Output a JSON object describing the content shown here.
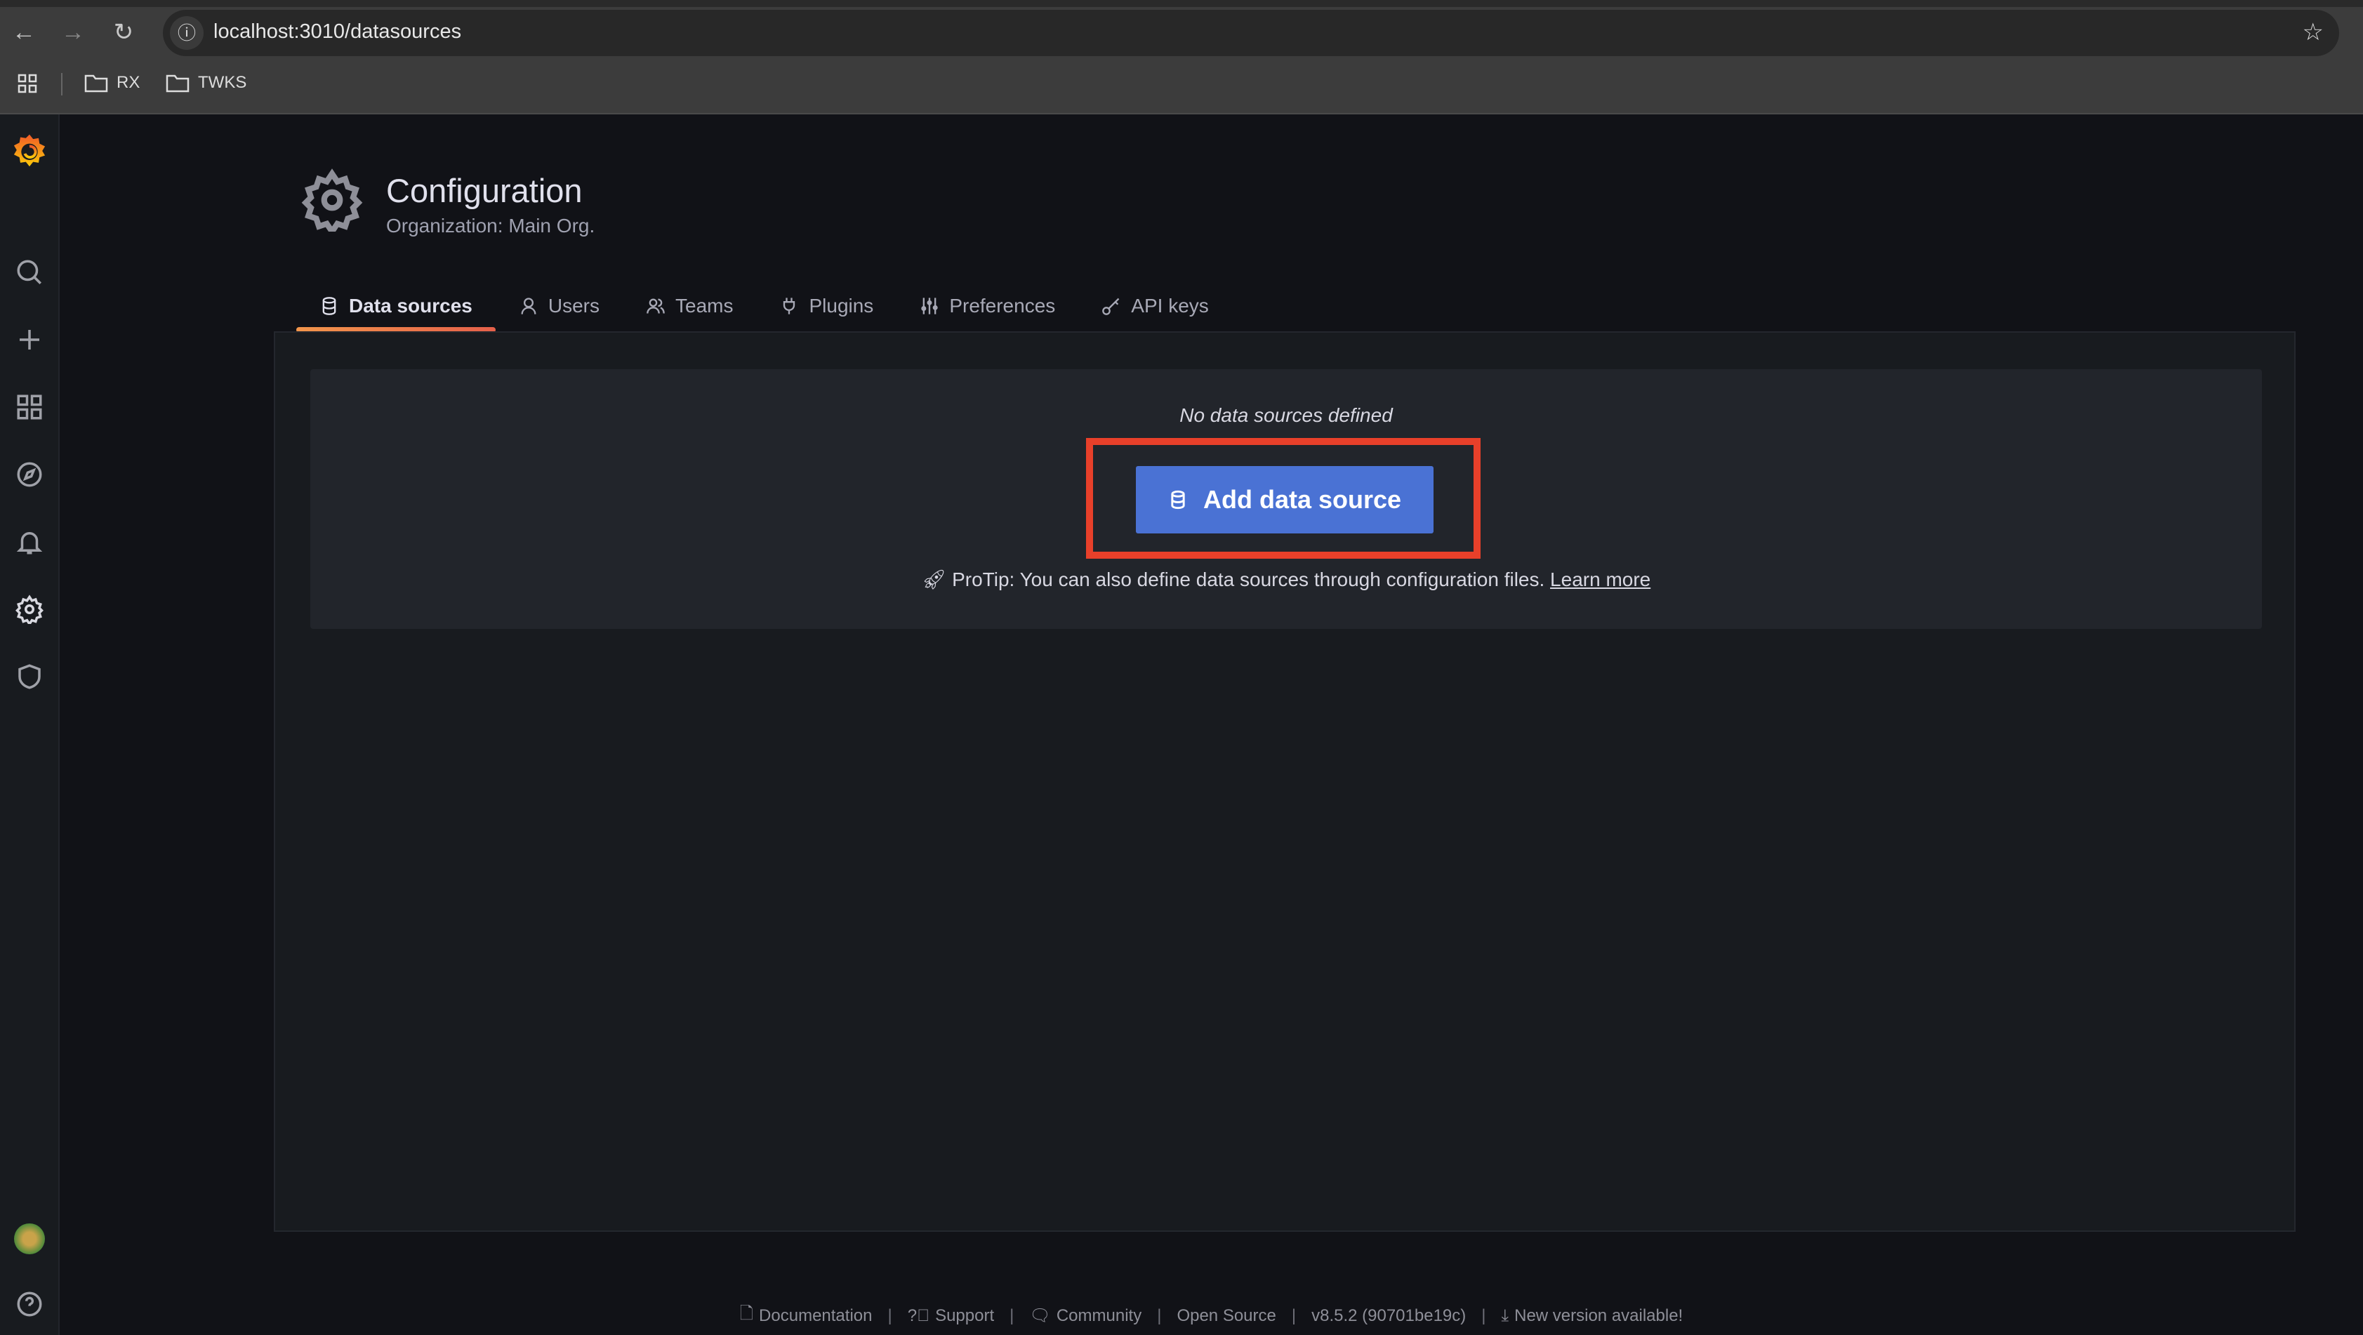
{
  "browser": {
    "url": "localhost:3010/datasources",
    "bookmarks": [
      {
        "label": "RX"
      },
      {
        "label": "TWKS"
      }
    ]
  },
  "header": {
    "title": "Configuration",
    "subtitle": "Organization: Main Org."
  },
  "tabs": [
    {
      "label": "Data sources",
      "icon": "database-icon",
      "active": true
    },
    {
      "label": "Users",
      "icon": "user-icon"
    },
    {
      "label": "Teams",
      "icon": "users-icon"
    },
    {
      "label": "Plugins",
      "icon": "plug-icon"
    },
    {
      "label": "Preferences",
      "icon": "sliders-icon"
    },
    {
      "label": "API keys",
      "icon": "key-icon"
    }
  ],
  "main": {
    "empty_text": "No data sources defined",
    "add_button": "Add data source",
    "protip": "ProTip: You can also define data sources through configuration files.",
    "learn_more": "Learn more"
  },
  "footer": {
    "documentation": "Documentation",
    "support": "Support",
    "community": "Community",
    "open_source": "Open Source",
    "version": "v8.5.2 (90701be19c)",
    "new_version": "New version available!",
    "separator": "|"
  },
  "colors": {
    "accent": "#4a72d4",
    "highlight": "#e8402a",
    "tab_underline": "#f2954b"
  }
}
